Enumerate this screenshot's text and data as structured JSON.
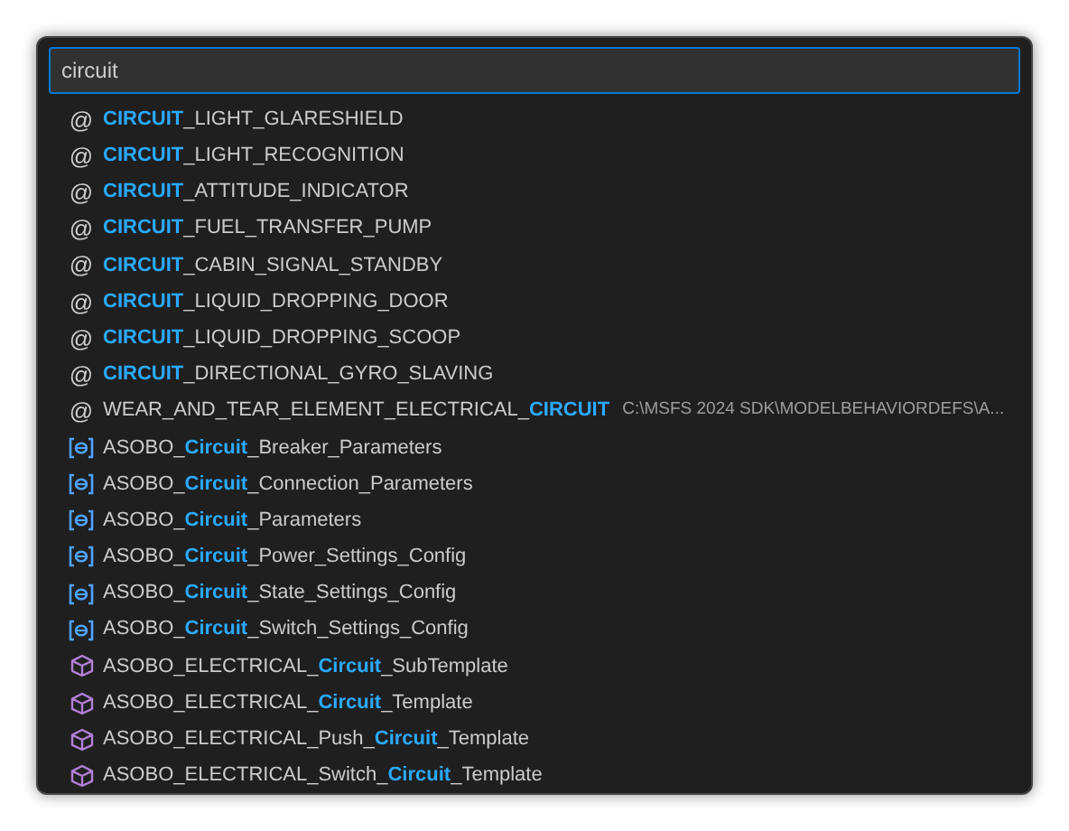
{
  "search": {
    "value": "circuit"
  },
  "items": [
    {
      "kind": "symbol",
      "icon": "@",
      "match": "CIRCUIT",
      "after": "_LIGHT_GLARESHIELD"
    },
    {
      "kind": "symbol",
      "icon": "@",
      "match": "CIRCUIT",
      "after": "_LIGHT_RECOGNITION"
    },
    {
      "kind": "symbol",
      "icon": "@",
      "match": "CIRCUIT",
      "after": "_ATTITUDE_INDICATOR"
    },
    {
      "kind": "symbol",
      "icon": "@",
      "match": "CIRCUIT",
      "after": "_FUEL_TRANSFER_PUMP"
    },
    {
      "kind": "symbol",
      "icon": "@",
      "match": "CIRCUIT",
      "after": "_CABIN_SIGNAL_STANDBY"
    },
    {
      "kind": "symbol",
      "icon": "@",
      "match": "CIRCUIT",
      "after": "_LIQUID_DROPPING_DOOR"
    },
    {
      "kind": "symbol",
      "icon": "@",
      "match": "CIRCUIT",
      "after": "_LIQUID_DROPPING_SCOOP"
    },
    {
      "kind": "symbol",
      "icon": "@",
      "match": "CIRCUIT",
      "after": "_DIRECTIONAL_GYRO_SLAVING"
    },
    {
      "kind": "symbol",
      "icon": "@",
      "before": "WEAR_AND_TEAR_ELEMENT_ELECTRICAL_",
      "match": "CIRCUIT",
      "detail": "C:\\MSFS 2024 SDK\\MODELBEHAVIORDEFS\\A..."
    },
    {
      "kind": "variable",
      "before": "ASOBO_",
      "match": "Circuit",
      "after": "_Breaker_Parameters"
    },
    {
      "kind": "variable",
      "before": "ASOBO_",
      "match": "Circuit",
      "after": "_Connection_Parameters"
    },
    {
      "kind": "variable",
      "before": "ASOBO_",
      "match": "Circuit",
      "after": "_Parameters"
    },
    {
      "kind": "variable",
      "before": "ASOBO_",
      "match": "Circuit",
      "after": "_Power_Settings_Config"
    },
    {
      "kind": "variable",
      "before": "ASOBO_",
      "match": "Circuit",
      "after": "_State_Settings_Config"
    },
    {
      "kind": "variable",
      "before": "ASOBO_",
      "match": "Circuit",
      "after": "_Switch_Settings_Config"
    },
    {
      "kind": "module",
      "before": "ASOBO_ELECTRICAL_",
      "match": "Circuit",
      "after": "_SubTemplate"
    },
    {
      "kind": "module",
      "before": "ASOBO_ELECTRICAL_",
      "match": "Circuit",
      "after": "_Template"
    },
    {
      "kind": "module",
      "before": "ASOBO_ELECTRICAL_Push_",
      "match": "Circuit",
      "after": "_Template"
    },
    {
      "kind": "module",
      "before": "ASOBO_ELECTRICAL_Switch_",
      "match": "Circuit",
      "after": "_Template"
    }
  ]
}
